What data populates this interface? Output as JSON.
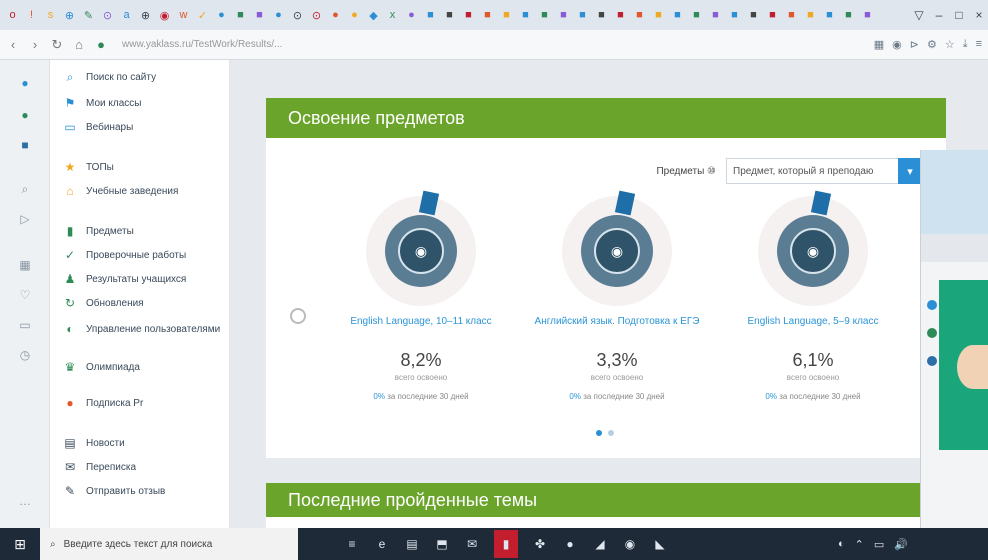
{
  "browser": {
    "url": "www.yaklass.ru/TestWork/Results/...",
    "tab_icons": [
      "o",
      "!",
      "s",
      "⊕",
      "✎",
      "⊙",
      "a",
      "⊕",
      "◉",
      "w",
      "✓",
      "●",
      "■",
      "■",
      "●",
      "⊙",
      "⊙",
      "●",
      "●",
      "◆",
      "x",
      "●",
      "■",
      "■",
      "■",
      "■",
      "■",
      "■",
      "■",
      "■",
      "■",
      "■",
      "■",
      "■",
      "■",
      "■",
      "■",
      "■",
      "■",
      "■",
      "■",
      "■",
      "■",
      "■",
      "■",
      "■"
    ],
    "window_controls": [
      "▽",
      "–",
      "□",
      "×"
    ]
  },
  "site_nav": {
    "items": [
      {
        "label": "Поиск по сайту",
        "icon": "search-icon",
        "color": "#2b8fd6"
      },
      {
        "label": "Мои классы",
        "icon": "classes-icon",
        "color": "#2b8fd6"
      },
      {
        "label": "Вебинары",
        "icon": "webinar-icon",
        "color": "#2b8fd6"
      },
      {
        "label": "ТОПы",
        "icon": "star-icon",
        "color": "#f0a820"
      },
      {
        "label": "Учебные заведения",
        "icon": "school-icon",
        "color": "#f0a820"
      },
      {
        "label": "Предметы",
        "icon": "subjects-icon",
        "color": "#2e8b57"
      },
      {
        "label": "Проверочные работы",
        "icon": "check-icon",
        "color": "#2e8b57"
      },
      {
        "label": "Результаты учащихся",
        "icon": "results-icon",
        "color": "#2e8b57"
      },
      {
        "label": "Обновления",
        "icon": "update-icon",
        "color": "#2e8b57"
      },
      {
        "label": "Управление пользователями",
        "icon": "users-icon",
        "color": "#2e8b57"
      },
      {
        "label": "Олимпиада",
        "icon": "olympiad-icon",
        "color": "#2e8b57"
      },
      {
        "label": "Подписка Pr",
        "icon": "subscription-icon",
        "color": "#e0572a"
      },
      {
        "label": "Новости",
        "icon": "news-icon",
        "color": "#3a4a5a"
      },
      {
        "label": "Переписка",
        "icon": "messages-icon",
        "color": "#3a4a5a"
      },
      {
        "label": "Отправить отзыв",
        "icon": "feedback-icon",
        "color": "#3a4a5a"
      }
    ]
  },
  "mastery": {
    "header": "Освоение предметов",
    "subject_label": "Предметы ⑩",
    "subject_select": "Предмет, который я преподаю",
    "courses": [
      {
        "title": "English Language, 10–11 класс",
        "percent": "8,2%",
        "sub": "всего освоено",
        "delta_pct": "0%",
        "delta_text": "за последние 30 дней"
      },
      {
        "title": "Английский язык. Подготовка к ЕГЭ",
        "percent": "3,3%",
        "sub": "всего освоено",
        "delta_pct": "0%",
        "delta_text": "за последние 30 дней"
      },
      {
        "title": "English Language, 5–9 класс",
        "percent": "6,1%",
        "sub": "всего освоено",
        "delta_pct": "0%",
        "delta_text": "за последние 30 дней"
      }
    ]
  },
  "recent": {
    "header": "Последние пройденные темы"
  },
  "taskbar": {
    "search_placeholder": "Введите здесь текст для поиска",
    "start_glyph": "⊞",
    "apps": [
      "≡",
      "e",
      "▤",
      "⬒",
      "✉",
      "▮",
      "✤",
      "●",
      "◢",
      "◉",
      "◣"
    ],
    "tray": [
      "◐",
      "⌃",
      "▭",
      "🔊"
    ]
  },
  "colors": {
    "accent_green": "#6aa42a",
    "accent_blue": "#2b8fd6",
    "taskbar": "#1e2a38"
  }
}
